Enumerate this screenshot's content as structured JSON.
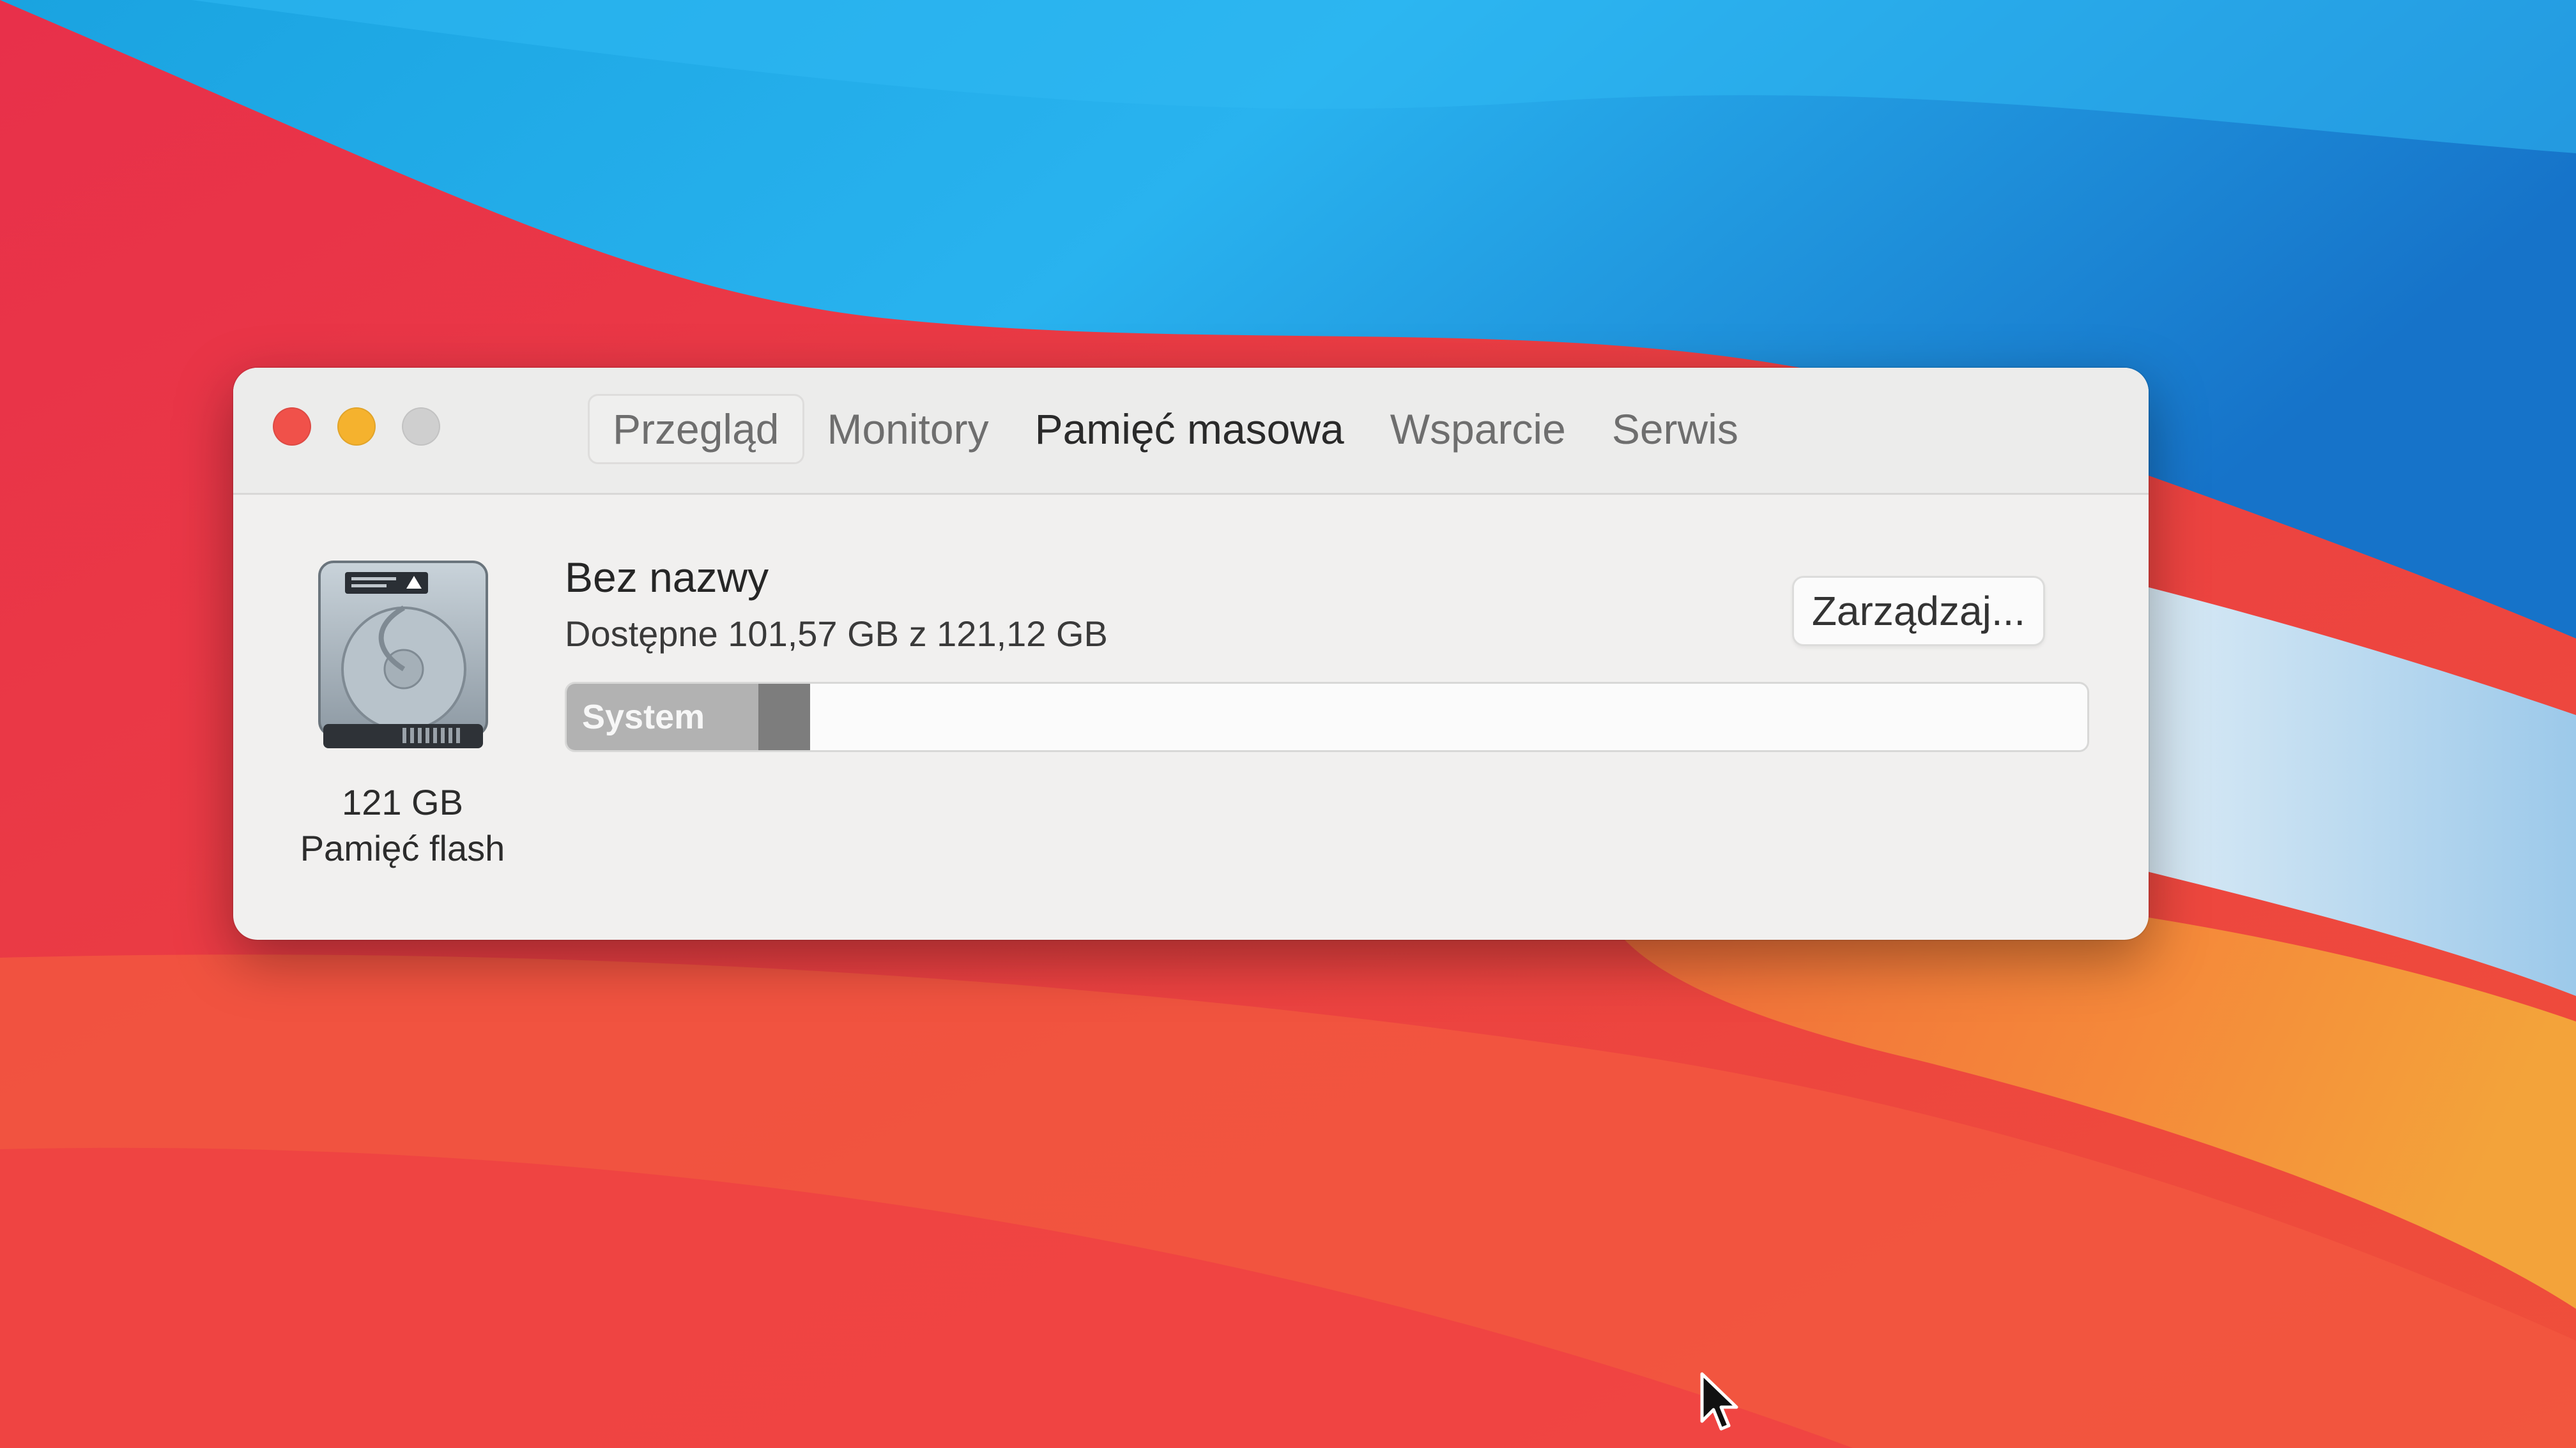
{
  "window": {
    "tabs": [
      {
        "label": "Przegląd",
        "selected": false
      },
      {
        "label": "Monitory",
        "selected": false
      },
      {
        "label": "Pamięć masowa",
        "selected": true
      },
      {
        "label": "Wsparcie",
        "selected": false
      },
      {
        "label": "Serwis",
        "selected": false
      }
    ],
    "traffic_lights": {
      "close_color": "#f0514a",
      "minimize_color": "#f5b22e",
      "zoom_color": "#cfcfcf"
    }
  },
  "disk": {
    "icon": "hard-drive-icon",
    "size": "121 GB",
    "kind": "Pamięć flash"
  },
  "volume": {
    "name": "Bez nazwy",
    "availability": "Dostępne 101,57 GB z 121,12 GB",
    "manage_button": "Zarządzaj...",
    "storage_bar": {
      "segments": [
        {
          "label": "System",
          "fraction": 0.126,
          "color": "#b2b2b2"
        },
        {
          "label": "",
          "fraction": 0.034,
          "color": "#7d7d7d"
        }
      ]
    }
  }
}
